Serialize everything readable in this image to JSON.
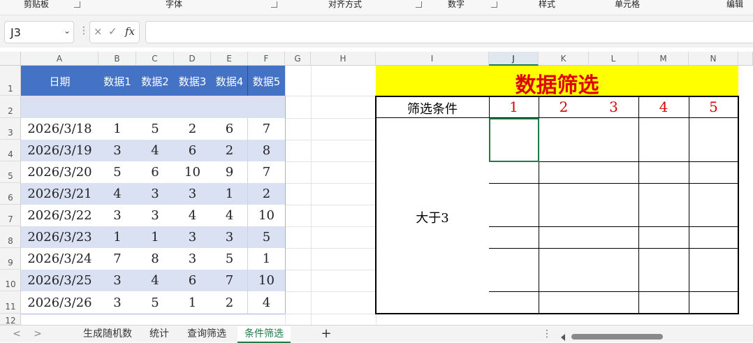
{
  "ribbon": {
    "groups": [
      "剪贴板",
      "字体",
      "对齐方式",
      "数字",
      "样式",
      "单元格",
      "编辑"
    ]
  },
  "formula_bar": {
    "name_box": "J3",
    "cancel": "×",
    "enter": "✓",
    "fx": "fx",
    "formula": ""
  },
  "columns": [
    "A",
    "B",
    "C",
    "D",
    "E",
    "F",
    "G",
    "H",
    "I",
    "J",
    "K",
    "L",
    "M",
    "N"
  ],
  "rows": [
    "1",
    "2",
    "3",
    "4",
    "5",
    "6",
    "7",
    "8",
    "9",
    "10",
    "11",
    "12"
  ],
  "data_table": {
    "headers": [
      "日期",
      "数据1",
      "数据2",
      "数据3",
      "数据4",
      "数据5"
    ],
    "rows": [
      [
        "2026/3/18",
        "1",
        "5",
        "2",
        "6",
        "7"
      ],
      [
        "2026/3/19",
        "3",
        "4",
        "6",
        "2",
        "8"
      ],
      [
        "2026/3/20",
        "5",
        "6",
        "10",
        "9",
        "7"
      ],
      [
        "2026/3/21",
        "4",
        "3",
        "3",
        "1",
        "2"
      ],
      [
        "2026/3/22",
        "3",
        "3",
        "4",
        "4",
        "10"
      ],
      [
        "2026/3/23",
        "1",
        "1",
        "3",
        "3",
        "5"
      ],
      [
        "2026/3/24",
        "7",
        "8",
        "3",
        "5",
        "1"
      ],
      [
        "2026/3/25",
        "3",
        "4",
        "6",
        "7",
        "10"
      ],
      [
        "2026/3/26",
        "3",
        "5",
        "1",
        "2",
        "4"
      ]
    ],
    "header_color": "#4472c4",
    "band_color": "#d9e1f2"
  },
  "filter_panel": {
    "title": "数据筛选",
    "title_bg": "#ffff00",
    "title_color": "#e00000",
    "criteria_label": "筛选条件",
    "columns": [
      "1",
      "2",
      "3",
      "4",
      "5"
    ],
    "condition": "大于3"
  },
  "sheet_tabs": {
    "prev": "<",
    "next": ">",
    "tabs": [
      "生成随机数",
      "统计",
      "查询筛选",
      "条件筛选"
    ],
    "active": "条件筛选",
    "add": "+",
    "more": "⋮"
  }
}
